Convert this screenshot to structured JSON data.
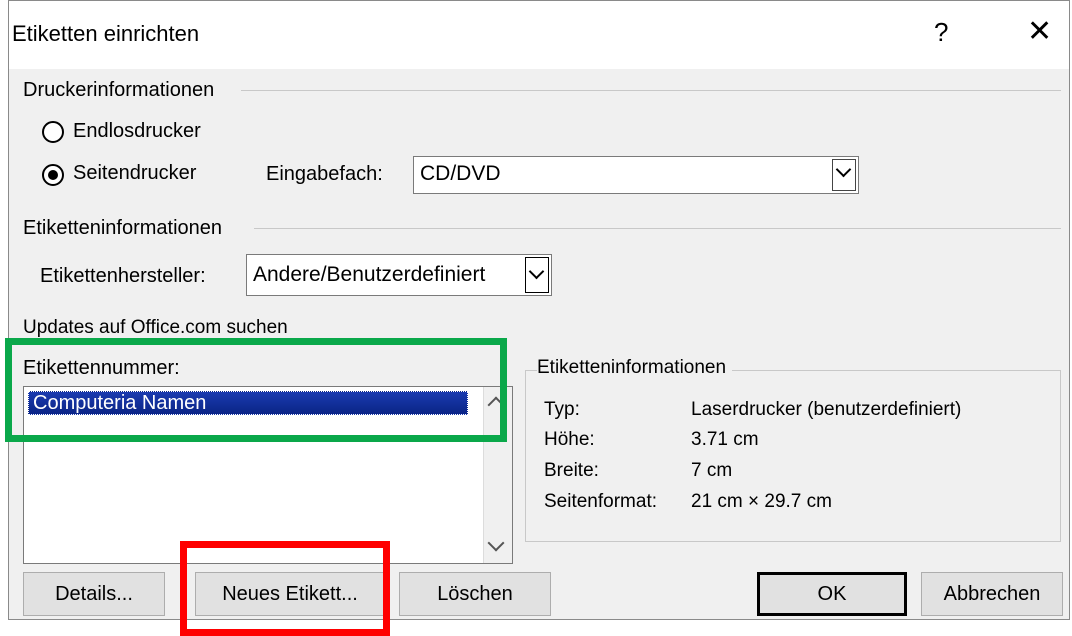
{
  "window": {
    "title": "Etiketten einrichten",
    "help_label": "?",
    "close_label": "✕"
  },
  "printer_info": {
    "group_label": "Druckerinformationen",
    "continuous_label": "Endlosdrucker",
    "page_printer_label": "Seitendrucker",
    "selected": "Seitendrucker",
    "tray_label": "Eingabefach:",
    "tray_value": "CD/DVD"
  },
  "label_info": {
    "group_label": "Etiketteninformationen",
    "vendor_label": "Etikettenhersteller:",
    "vendor_value": "Andere/Benutzerdefiniert",
    "updates_link": "Updates auf Office.com suchen"
  },
  "product_number": {
    "label": "Etikettennummer:",
    "items": [
      "Computeria Namen"
    ],
    "selected_index": 0
  },
  "details_panel": {
    "group_label": "Etiketteninformationen",
    "rows": [
      {
        "key": "Typ:",
        "value": "Laserdrucker (benutzerdefiniert)"
      },
      {
        "key": "Höhe:",
        "value": "3.71 cm"
      },
      {
        "key": "Breite:",
        "value": "7 cm"
      },
      {
        "key": "Seitenformat:",
        "value": "21 cm × 29.7 cm"
      }
    ]
  },
  "buttons": {
    "details": "Details...",
    "new_label": "Neues Etikett...",
    "delete": "Löschen",
    "ok": "OK",
    "cancel": "Abbrechen"
  },
  "highlights": {
    "green_color": "#0aa84a",
    "red_color": "#ff0000"
  }
}
